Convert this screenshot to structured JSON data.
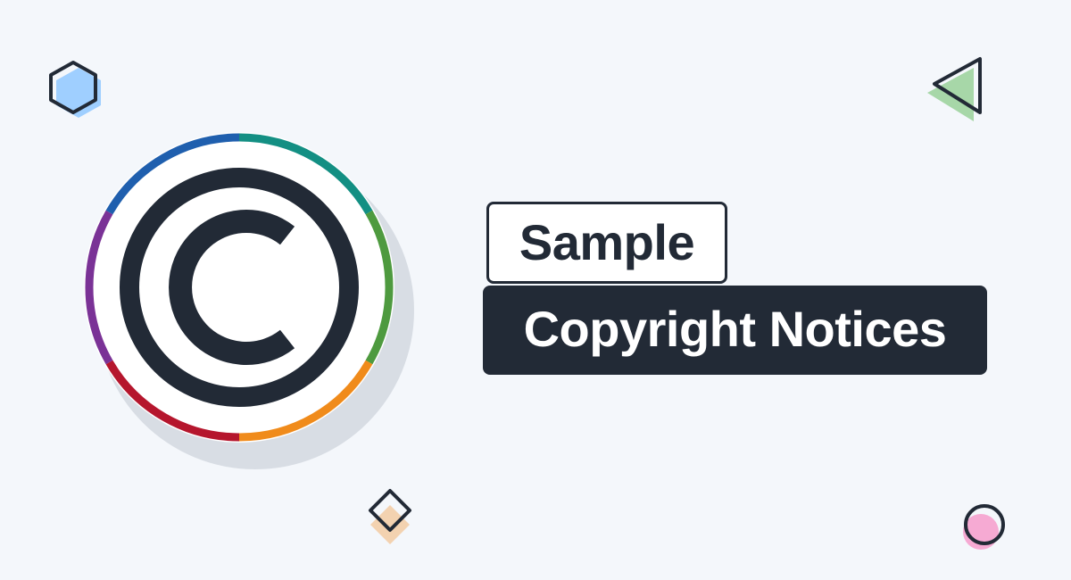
{
  "banner": {
    "title_line_1": "Sample",
    "title_line_2": "Copyright Notices"
  },
  "colors": {
    "background": "#f4f7fb",
    "dark": "#222a36",
    "badge_shadow": "#d8dde4",
    "hexagon_fill": "#9fcfff",
    "triangle_fill": "#a7d7a8",
    "diamond_fill": "#f3d2b0",
    "circle_fill": "#f6aad3",
    "ring_segments": [
      "#1f5fae",
      "#138f83",
      "#4e9a3f",
      "#f08b1b",
      "#b5162d",
      "#7a3296"
    ]
  },
  "icons": {
    "copyright": "copyright-icon",
    "hexagon": "hexagon-icon",
    "triangle": "triangle-icon",
    "diamond": "diamond-icon",
    "circle": "circle-icon"
  }
}
